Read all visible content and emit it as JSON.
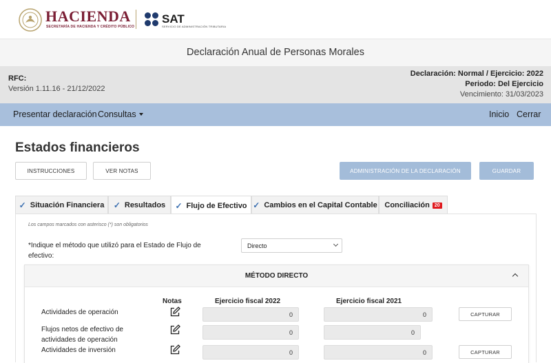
{
  "header": {
    "hacienda_title": "HACIENDA",
    "hacienda_subtitle": "SECRETARÍA DE HACIENDA Y CRÉDITO PÚBLICO",
    "sat_title": "SAT",
    "sat_subtitle": "SERVICIO DE ADMINISTRACIÓN TRIBUTARIA",
    "brand_color": "#7b1f35"
  },
  "page_title": "Declaración Anual de Personas Morales",
  "info": {
    "rfc_label": "RFC:",
    "version": "Versión 1.11.16 - 21/12/2022",
    "declaracion": "Declaración: Normal / Ejercicio: 2022",
    "periodo": "Periodo: Del Ejercicio",
    "vencimiento": "Vencimiento: 31/03/2023"
  },
  "nav": {
    "presentar": "Presentar declaración",
    "consultas": "Consultas",
    "inicio": "Inicio",
    "cerrar": "Cerrar"
  },
  "section_title": "Estados financieros",
  "buttons": {
    "instrucciones": "INSTRUCCIONES",
    "ver_notas": "VER NOTAS",
    "administracion": "ADMINISTRACIÓN DE LA DECLARACIÓN",
    "guardar": "GUARDAR"
  },
  "tabs": [
    {
      "label": "Situación Financiera",
      "checked": true
    },
    {
      "label": "Resultados",
      "checked": true
    },
    {
      "label": "Flujo de Efectivo",
      "checked": true,
      "active": true
    },
    {
      "label": "Cambios en el Capital Contable",
      "checked": true
    },
    {
      "label": "Conciliación",
      "badge": "20"
    }
  ],
  "form": {
    "required_note": "Los campos marcados con asterisco (*) son obligatorios",
    "method_question": "*Indique el método que utilizó para el Estado de Flujo de efectivo:",
    "method_value": "Directo"
  },
  "direct_method": {
    "title": "MÉTODO DIRECTO",
    "col_notas": "Notas",
    "col_2022": "Ejercicio fiscal 2022",
    "col_2021": "Ejercicio fiscal 2021",
    "capture_label": "CAPTURAR",
    "rows": [
      {
        "label": "Actividades de operación",
        "v2022": "0",
        "v2021": "0"
      },
      {
        "label": "Flujos netos de efectivo de actividades de operación",
        "v2022": "0",
        "v2021": "0"
      },
      {
        "label": "Actividades de inversión",
        "v2022": "0",
        "v2021": "0"
      }
    ]
  }
}
